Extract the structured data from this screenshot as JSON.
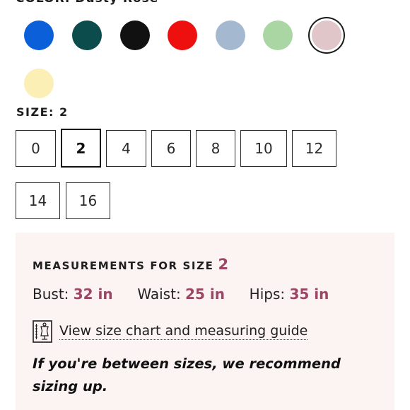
{
  "color": {
    "label": "COLOR: Dusty Rose",
    "swatches": [
      {
        "name": "blue",
        "hex": "#0b5fd9"
      },
      {
        "name": "teal",
        "hex": "#0d4c4c"
      },
      {
        "name": "black",
        "hex": "#111111"
      },
      {
        "name": "red",
        "hex": "#ee0f0f"
      },
      {
        "name": "light-blue",
        "hex": "#a4b8cf"
      },
      {
        "name": "sage",
        "hex": "#a9d6a3"
      },
      {
        "name": "dusty-rose",
        "hex": "#e0c5c9",
        "selected": true
      },
      {
        "name": "butter",
        "hex": "#fcefb5"
      }
    ]
  },
  "size": {
    "label": "SIZE: 2",
    "options": [
      "0",
      "2",
      "4",
      "6",
      "8",
      "10",
      "12",
      "14",
      "16"
    ],
    "selected": "2"
  },
  "measurements": {
    "title": "MEASUREMENTS FOR SIZE",
    "size": "2",
    "bust_label": "Bust:",
    "bust_value": "32 in",
    "waist_label": "Waist:",
    "waist_value": "25 in",
    "hips_label": "Hips:",
    "hips_value": "35 in",
    "chart_icon": "size-chart-icon",
    "chart_link": "View size chart and measuring guide",
    "advice": "If you're between sizes, we recommend sizing up."
  },
  "colors": {
    "accent": "#9a4664",
    "panel_bg": "#fcf4f2"
  }
}
